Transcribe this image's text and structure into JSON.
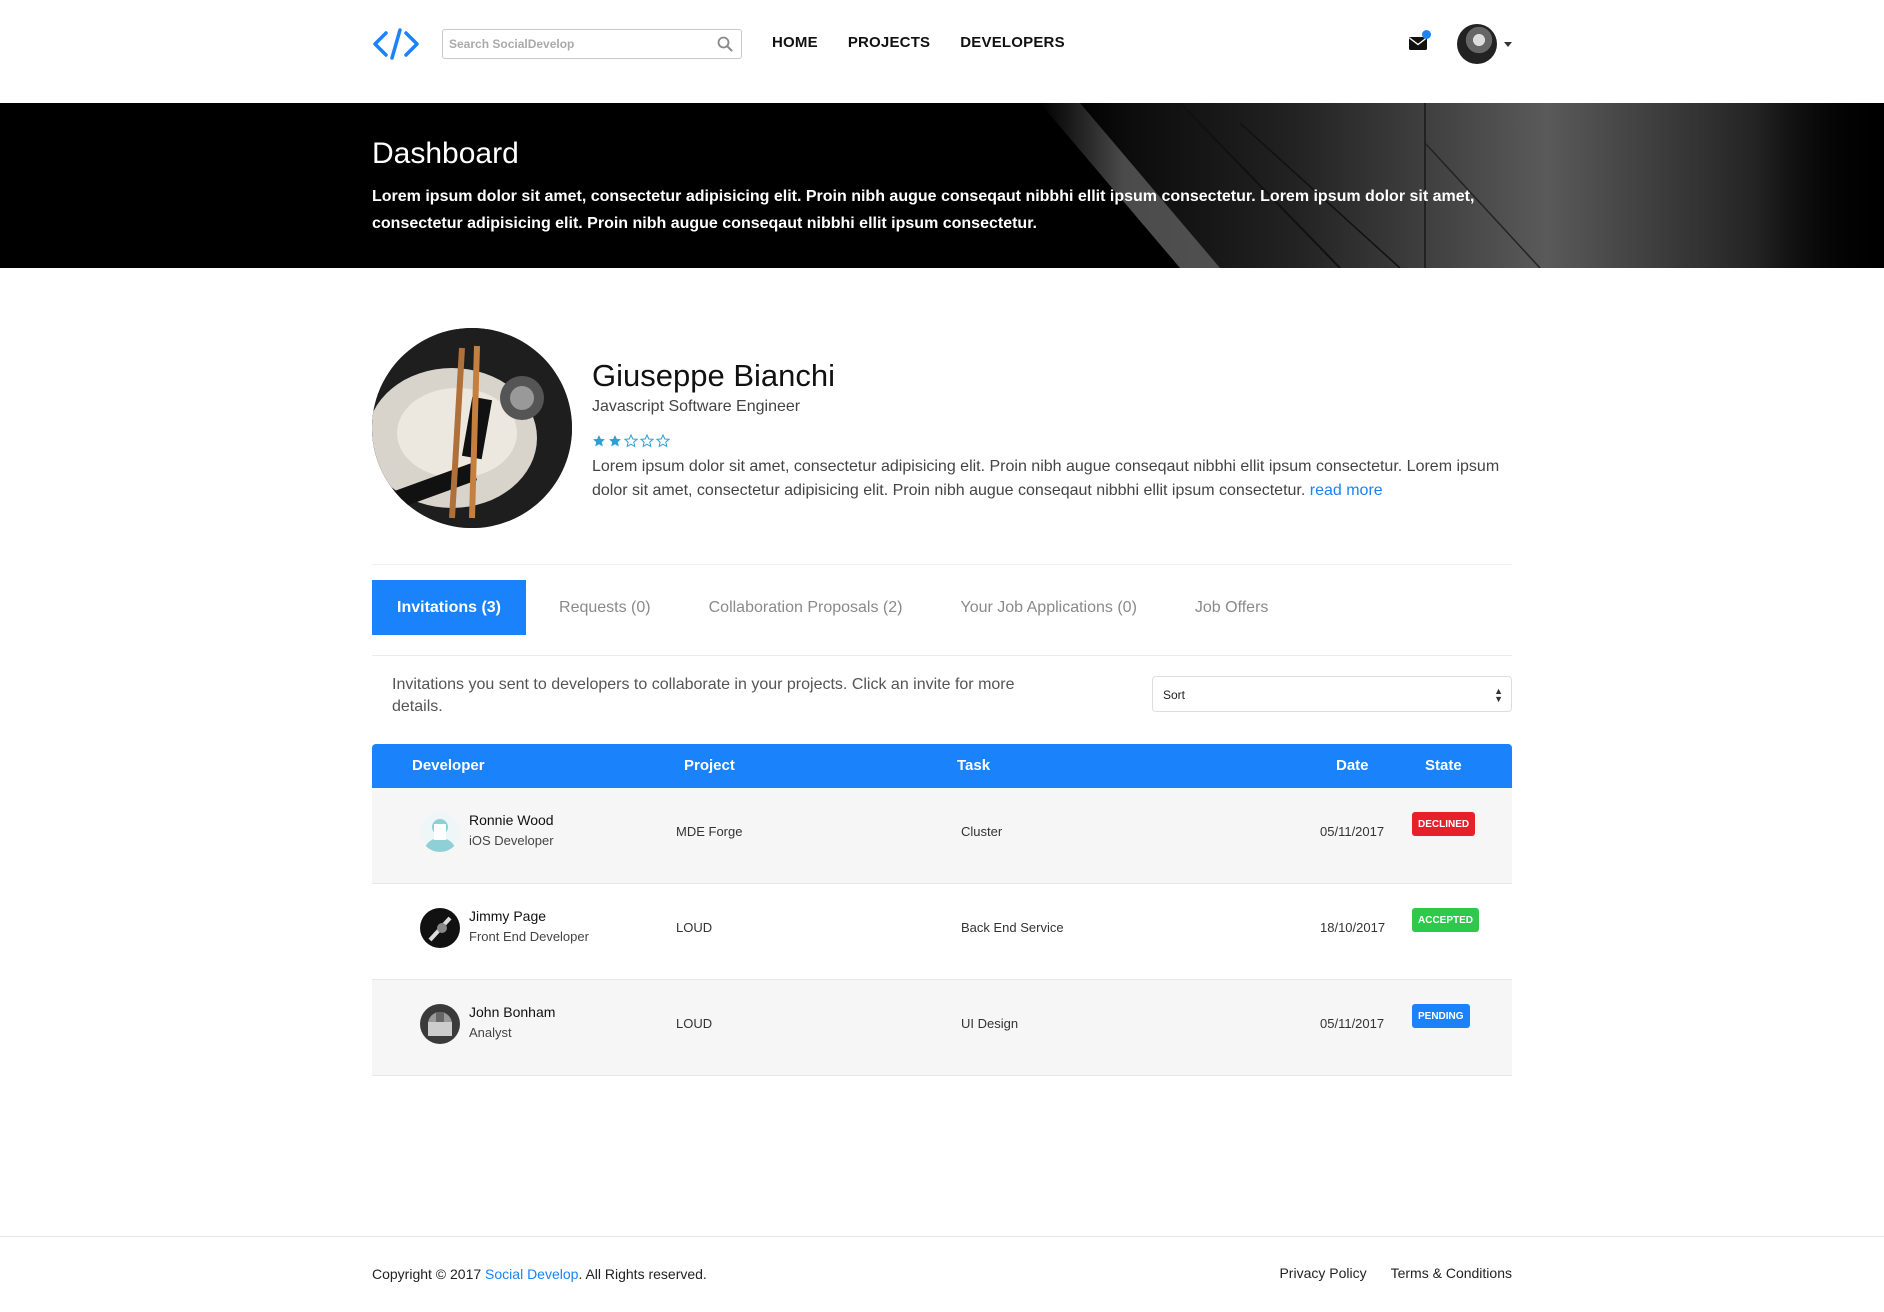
{
  "header": {
    "search_placeholder": "Search SocialDevelop",
    "nav": [
      "HOME",
      "PROJECTS",
      "DEVELOPERS"
    ]
  },
  "banner": {
    "title": "Dashboard",
    "text": "Lorem ipsum dolor sit amet, consectetur adipisicing elit. Proin nibh augue conseqaut nibbhi ellit ipsum consectetur. Lorem ipsum dolor sit amet, consectetur adipisicing elit. Proin nibh augue conseqaut nibbhi ellit ipsum consectetur."
  },
  "profile": {
    "name": "Giuseppe Bianchi",
    "role": "Javascript Software Engineer",
    "rating": 2,
    "rating_max": 5,
    "bio": "Lorem ipsum dolor sit amet, consectetur adipisicing elit. Proin nibh augue conseqaut nibbhi ellit ipsum consectetur. Lorem ipsum dolor sit amet, consectetur adipisicing elit. Proin nibh augue conseqaut nibbhi ellit ipsum consectetur.",
    "read_more": "read more"
  },
  "tabs": [
    "Invitations (3)",
    "Requests (0)",
    "Collaboration Proposals (2)",
    "Your Job Applications (0)",
    "Job Offers"
  ],
  "active_tab": 0,
  "description": "Invitations you sent to developers to collaborate in your projects. Click an invite for more details.",
  "sort": {
    "selected": "Sort"
  },
  "table": {
    "headers": [
      "Developer",
      "Project",
      "Task",
      "Date",
      "State"
    ],
    "rows": [
      {
        "name": "Ronnie Wood",
        "role": "iOS Developer",
        "project": "MDE Forge",
        "task": "Cluster",
        "date": "05/11/2017",
        "state": "DECLINED",
        "state_color": "#e8202a"
      },
      {
        "name": "Jimmy Page",
        "role": "Front End Developer",
        "project": "LOUD",
        "task": "Back End Service",
        "date": "18/10/2017",
        "state": "ACCEPTED",
        "state_color": "#2ec94a"
      },
      {
        "name": "John Bonham",
        "role": "Analyst",
        "project": "LOUD",
        "task": "UI Design",
        "date": "05/11/2017",
        "state": "PENDING",
        "state_color": "#1a82fb"
      }
    ]
  },
  "footer": {
    "copyright_prefix": "Copyright © 2017 ",
    "brand": "Social Develop",
    "copyright_suffix": ". All Rights reserved.",
    "links": [
      "Privacy Policy",
      "Terms & Conditions"
    ]
  },
  "colors": {
    "accent": "#1a82fb"
  },
  "icons": [
    "code-logo-icon",
    "search-icon",
    "mail-icon",
    "star-icon",
    "caret-down-icon"
  ]
}
